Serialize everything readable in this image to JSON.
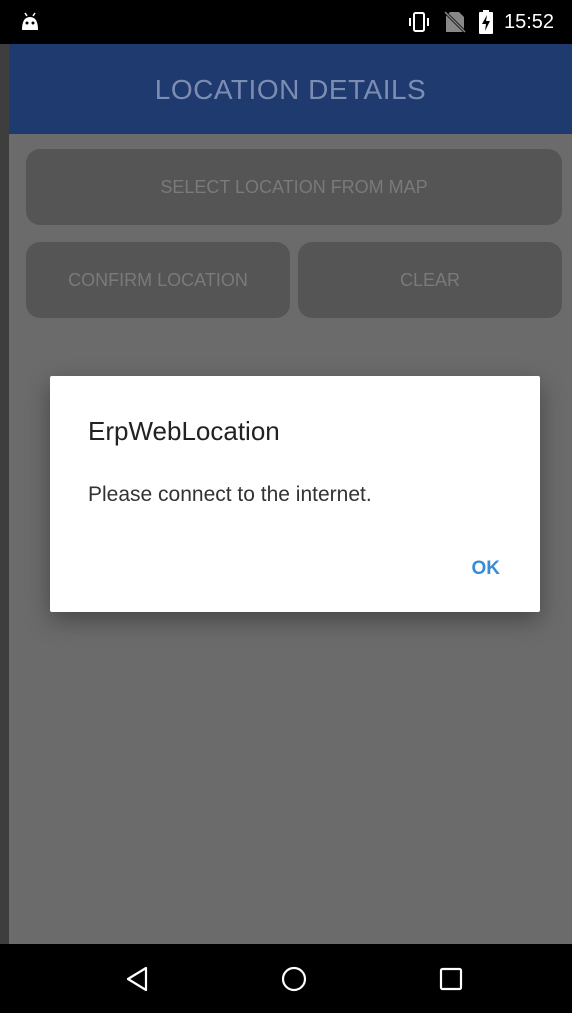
{
  "status_bar": {
    "time": "15:52",
    "icons": [
      "android-icon",
      "vibrate-icon",
      "no-sim-icon",
      "battery-charging-icon"
    ]
  },
  "app_bar": {
    "title": "LOCATION DETAILS"
  },
  "buttons": {
    "select_location": "SELECT LOCATION FROM MAP",
    "confirm_location": "CONFIRM LOCATION",
    "clear": "CLEAR"
  },
  "dialog": {
    "title": "ErpWebLocation",
    "message": "Please connect to the internet.",
    "ok_label": "OK"
  },
  "nav_bar": {
    "buttons": [
      "back-icon",
      "home-icon",
      "recents-icon"
    ]
  },
  "colors": {
    "app_bar": "#1e3a6f",
    "scrim_background": "#6b6b6b",
    "dialog_accent": "#3a8bd6"
  }
}
